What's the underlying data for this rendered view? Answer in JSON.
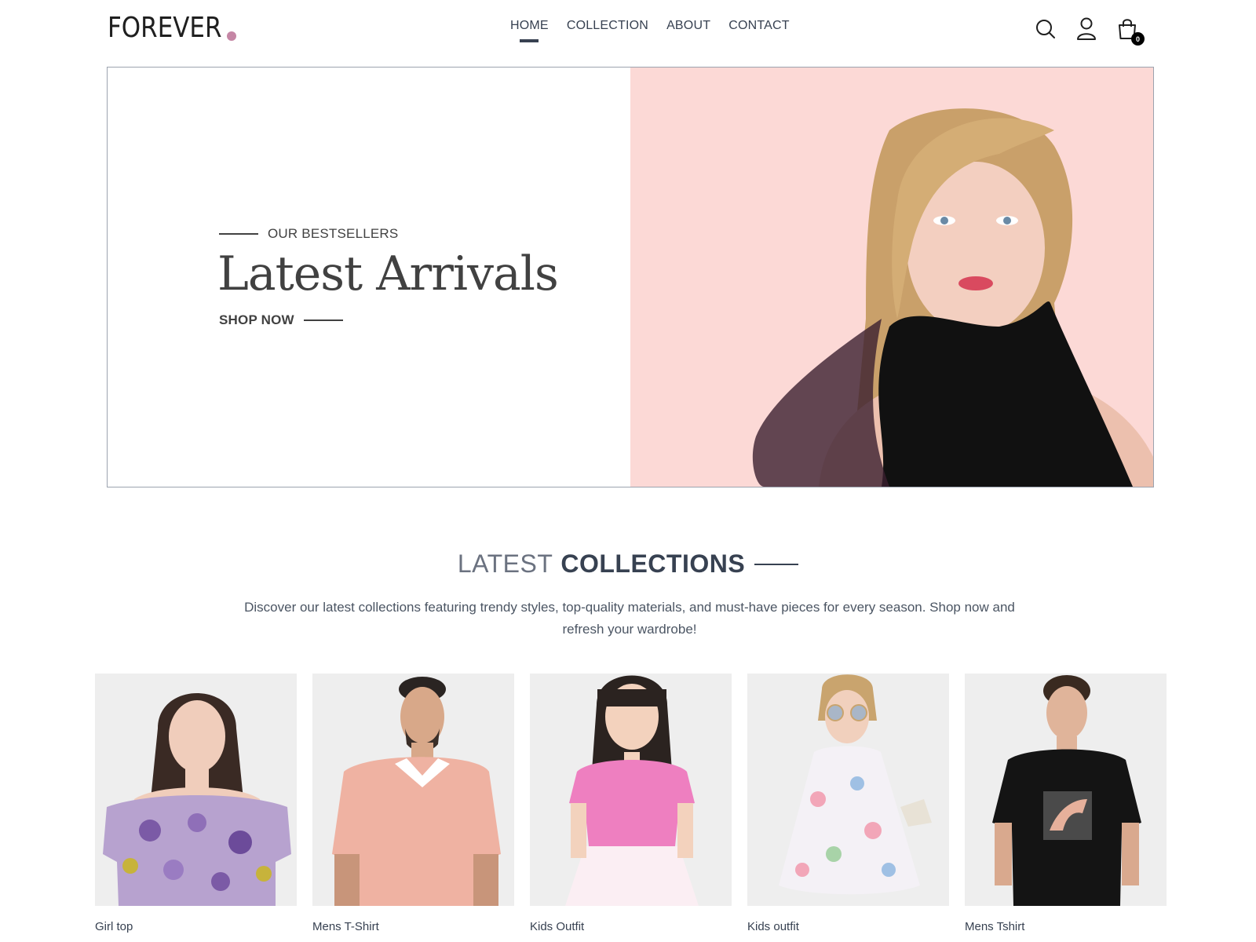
{
  "brand": {
    "logo_text": "FOREVER",
    "dot_color": "#c586a5"
  },
  "nav": {
    "items": [
      {
        "label": "HOME",
        "active": true
      },
      {
        "label": "COLLECTION",
        "active": false
      },
      {
        "label": "ABOUT",
        "active": false
      },
      {
        "label": "CONTACT",
        "active": false
      }
    ]
  },
  "header_icons": {
    "search": "search-icon",
    "profile": "user-icon",
    "cart": "shopping-bag-icon",
    "cart_count": "0"
  },
  "hero": {
    "eyebrow": "OUR BESTSELLERS",
    "title": "Latest Arrivals",
    "cta": "SHOP NOW",
    "image_bg": "#fcd9d6"
  },
  "latest": {
    "title_light": "LATEST",
    "title_bold": "COLLECTIONS",
    "description": "Discover our latest collections featuring trendy styles, top-quality materials, and must-have pieces for every season. Shop now and refresh your wardrobe!"
  },
  "products": [
    {
      "name": "Girl top"
    },
    {
      "name": "Mens T-Shirt"
    },
    {
      "name": "Kids Outfit"
    },
    {
      "name": "Kids outfit"
    },
    {
      "name": "Mens Tshirt"
    }
  ]
}
